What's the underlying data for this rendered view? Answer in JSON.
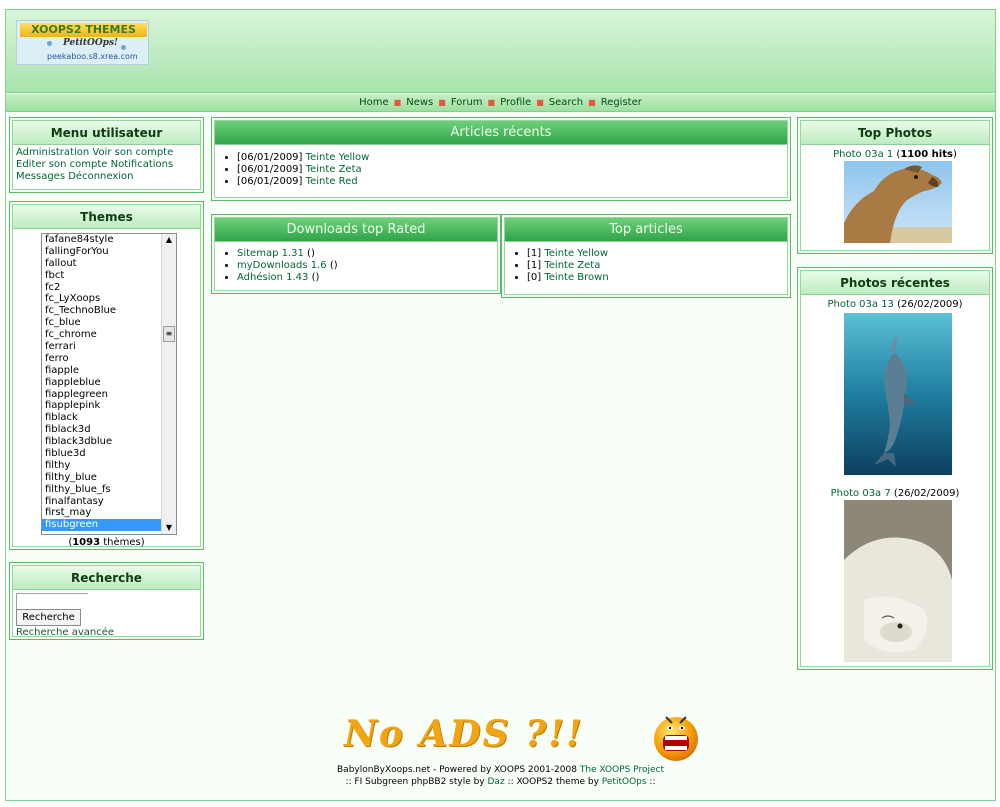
{
  "logo": {
    "line1": "XOOPS2 THEMES",
    "line2": "PetitOOps!",
    "line3": "peekaboo.s8.xrea.com"
  },
  "nav": {
    "items": [
      "Home",
      "News",
      "Forum",
      "Profile",
      "Search",
      "Register"
    ],
    "separator": "■"
  },
  "user_menu": {
    "title": "Menu utilisateur",
    "links": [
      "Administration",
      "Voir son compte",
      "Editer son compte",
      "Notifications",
      "Messages",
      "Déconnexion"
    ]
  },
  "themes": {
    "title": "Themes",
    "options": [
      "fafane84style",
      "fallingForYou",
      "fallout",
      "fbct",
      "fc2",
      "fc_LyXoops",
      "fc_TechnoBlue",
      "fc_blue",
      "fc_chrome",
      "ferrari",
      "ferro",
      "fiapple",
      "fiappleblue",
      "fiapplegreen",
      "fiapplepink",
      "fiblack",
      "fiblack3d",
      "fiblack3dblue",
      "fiblue3d",
      "filthy",
      "filthy_blue",
      "filthy_blue_fs",
      "finalfantasy",
      "first_may",
      "fisubgreen"
    ],
    "selected": "fisubgreen",
    "count_prefix": "(",
    "count": "1093",
    "count_suffix": " thèmes)"
  },
  "search": {
    "title": "Recherche",
    "input_value": "",
    "button_label": "Recherche",
    "advanced_link": "Recherche avancée"
  },
  "recent_articles": {
    "title": "Articles récents",
    "items": [
      {
        "date": "[06/01/2009]",
        "title": "Teinte Yellow"
      },
      {
        "date": "[06/01/2009]",
        "title": "Teinte Zeta"
      },
      {
        "date": "[06/01/2009]",
        "title": "Teinte Red"
      }
    ]
  },
  "downloads": {
    "title": "Downloads top Rated",
    "items": [
      {
        "title": "Sitemap 1.31",
        "suffix": " ()"
      },
      {
        "title": "myDownloads 1.6",
        "suffix": " ()"
      },
      {
        "title": "Adhésion 1.43",
        "suffix": " ()"
      }
    ]
  },
  "top_articles": {
    "title": "Top articles",
    "items": [
      {
        "rank": "[1]",
        "title": "Teinte Yellow"
      },
      {
        "rank": "[1]",
        "title": "Teinte Zeta"
      },
      {
        "rank": "[0]",
        "title": "Teinte Brown"
      }
    ]
  },
  "top_photos": {
    "title": "Top Photos",
    "items": [
      {
        "title": "Photo 03a 1",
        "info": "1100 hits"
      }
    ]
  },
  "recent_photos": {
    "title": "Photos récentes",
    "items": [
      {
        "title": "Photo 03a 13",
        "info": " (26/02/2009)"
      },
      {
        "title": "Photo 03a 7",
        "info": " (26/02/2009)"
      }
    ]
  },
  "ad": {
    "text": "No ADS ?!!"
  },
  "footer": {
    "line1_prefix": "BabylonByXoops.net - Powered by XOOPS 2001-2008 ",
    "line1_link": "The XOOPS Project",
    "line2_prefix": ":: FI Subgreen phpBB2 style by ",
    "line2_link1": "Daz",
    "line2_mid": " :: XOOPS2 theme by ",
    "line2_link2": "PetitOOps",
    "line2_suffix": " ::"
  },
  "colors": {
    "accent": "#2fa44a",
    "header": "#a9e4ad",
    "link": "#006633",
    "selected": "#3399ff"
  }
}
